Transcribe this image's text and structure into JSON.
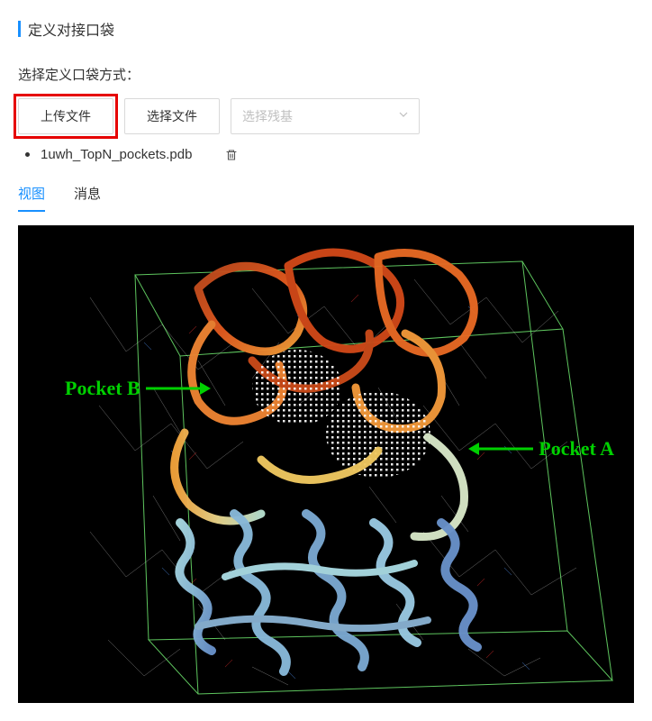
{
  "section": {
    "title": "定义对接口袋"
  },
  "form": {
    "label": "选择定义口袋方式：",
    "upload_btn": "上传文件",
    "choose_btn": "选择文件",
    "residue_select_placeholder": "选择残基"
  },
  "file": {
    "name": "1uwh_TopN_pockets.pdb"
  },
  "tabs": {
    "view": "视图",
    "messages": "消息"
  },
  "annotations": {
    "pocket_a": "Pocket A",
    "pocket_b": "Pocket B"
  }
}
